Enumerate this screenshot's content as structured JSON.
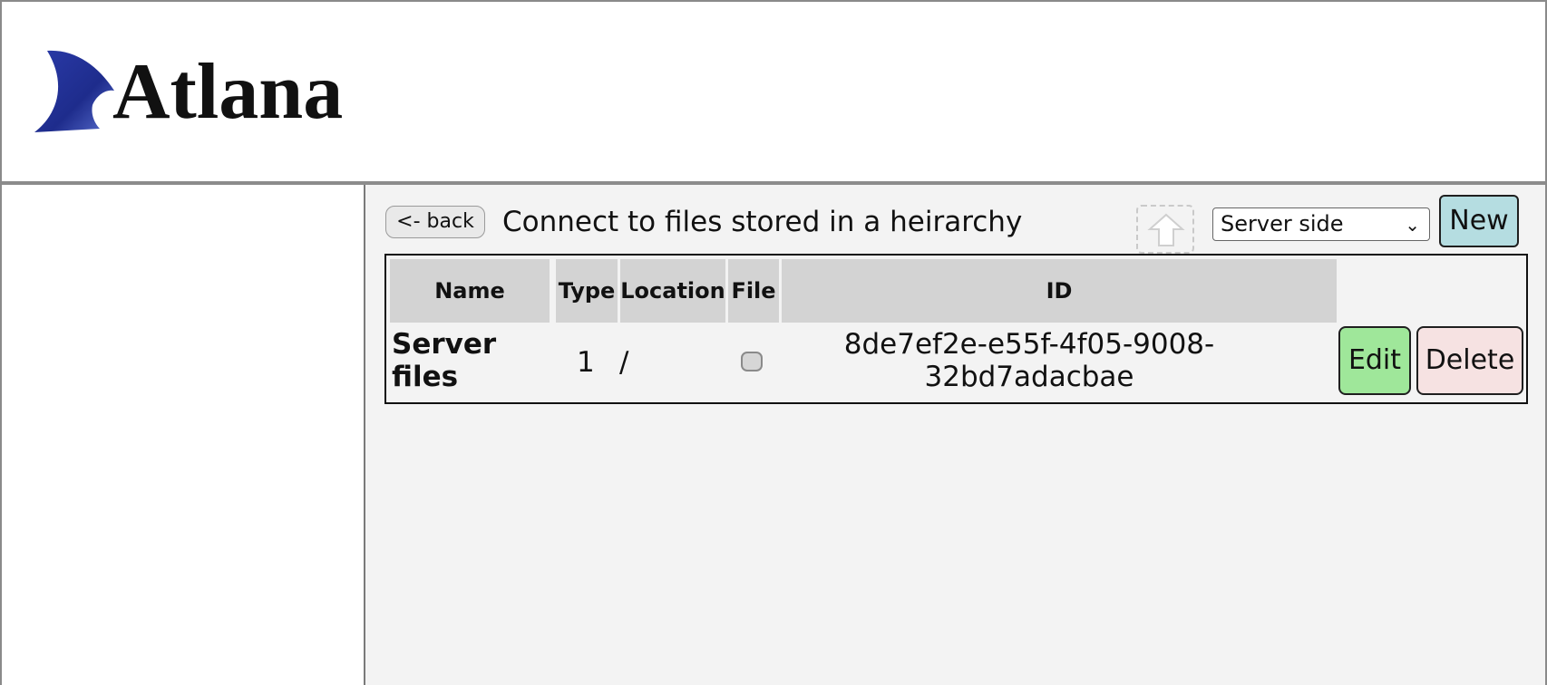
{
  "header": {
    "logo_text": "Atlana"
  },
  "toolbar": {
    "back_label": "<- back",
    "title": "Connect to files stored in a heirarchy",
    "upload_icon": "upload-arrow-icon",
    "select_value": "Server side",
    "new_label": "New"
  },
  "table": {
    "columns": [
      "Name",
      "Type",
      "Location",
      "File",
      "ID"
    ],
    "rows": [
      {
        "name": "Server files",
        "type": "1",
        "location": "/",
        "file": false,
        "id": "8de7ef2e-e55f-4f05-9008-32bd7adacbae",
        "edit_label": "Edit",
        "delete_label": "Delete"
      }
    ]
  },
  "colors": {
    "new_button": "#b5dde1",
    "edit_button": "#9fe79a",
    "delete_button": "#f6e2e2",
    "header_cell": "#d3d3d3",
    "main_background": "#f3f3f3"
  }
}
